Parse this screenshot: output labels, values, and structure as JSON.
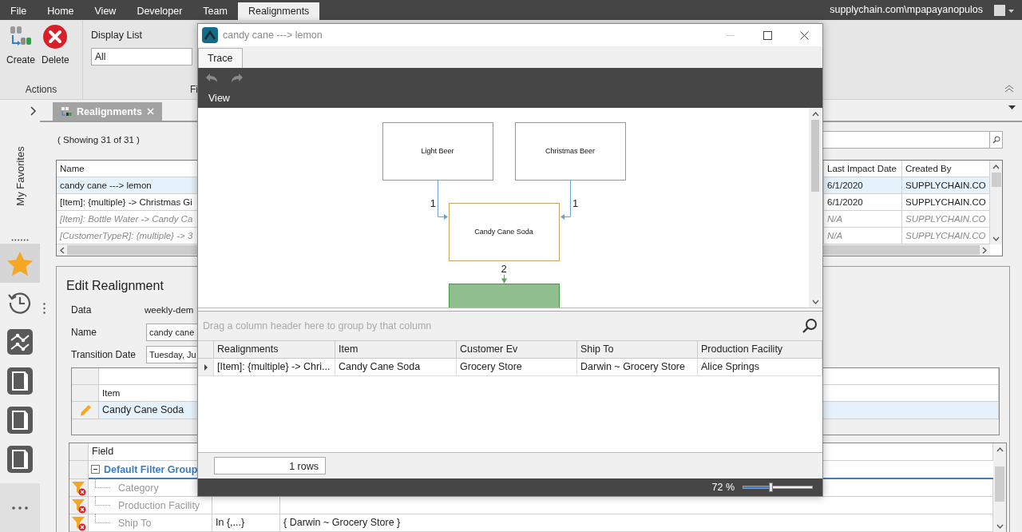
{
  "menu_bar": {
    "items": [
      {
        "label": "File",
        "selected": false
      },
      {
        "label": "Home",
        "selected": false
      },
      {
        "label": "View",
        "selected": false
      },
      {
        "label": "Developer",
        "selected": false
      },
      {
        "label": "Team",
        "selected": false
      },
      {
        "label": "Realignments",
        "selected": true
      }
    ],
    "user": "supplychain.com\\mpapayanopulos"
  },
  "ribbon": {
    "groups": [
      {
        "kind": "buttons",
        "label": "Actions",
        "buttons": [
          {
            "label": "Create",
            "kind": "create"
          },
          {
            "label": "Delete",
            "kind": "delete"
          }
        ]
      },
      {
        "kind": "list",
        "label": "Fi",
        "field_label": "Display List",
        "value": "All"
      }
    ]
  },
  "sidebar": {
    "title": "My Favorites",
    "items": [
      {
        "kind": "star",
        "selected": true
      },
      {
        "kind": "history",
        "selected": false
      },
      {
        "kind": "chart",
        "selected": false
      },
      {
        "kind": "document",
        "selected": false
      },
      {
        "kind": "document",
        "selected": false
      },
      {
        "kind": "document",
        "selected": false
      }
    ]
  },
  "document_tab": {
    "label": "Realignments"
  },
  "list": {
    "count": "( Showing 31 of 31 )",
    "columns": [
      "Name",
      "Last Impact Date",
      "Created By"
    ],
    "rows": [
      {
        "name": "candy cane ---> lemon",
        "last_impact_date": "6/1/2020",
        "created_by": "SUPPLYCHAIN.CO",
        "selected": true,
        "disabled": false
      },
      {
        "name": "[Item]: {multiple} -> Christmas Gi",
        "last_impact_date": "6/1/2020",
        "created_by": "SUPPLYCHAIN.CO",
        "selected": false,
        "disabled": false
      },
      {
        "name": "[Item]: Bottle Water -> Candy Ca",
        "last_impact_date": "N/A",
        "created_by": "SUPPLYCHAIN.CO",
        "selected": false,
        "disabled": true
      },
      {
        "name": "[CustomerTypeR]: {multiple} -> 3",
        "last_impact_date": "N/A",
        "created_by": "SUPPLYCHAIN.CO",
        "selected": false,
        "disabled": true
      }
    ]
  },
  "edit_panel": {
    "title": "Edit Realignment",
    "fields": [
      {
        "label": "Data",
        "value": "weekly-dem",
        "kind": "text"
      },
      {
        "label": "Name",
        "value": "candy cane",
        "kind": "input"
      },
      {
        "label": "Transition Date",
        "value": "Tuesday, Ju",
        "kind": "input"
      }
    ],
    "items_grid": {
      "column": "Item",
      "rows": [
        {
          "value": "Candy Cane Soda",
          "selected": true
        }
      ]
    },
    "filter_grid": {
      "column": "Field",
      "groups": [
        {
          "label": "Default Filter Group",
          "expanded": true,
          "children": [
            {
              "field": "Category"
            },
            {
              "field": "Production Facility"
            },
            {
              "field": "Ship To",
              "column_2": "In {,...}",
              "column_3": "{ Darwin ~ Grocery Store }"
            }
          ]
        }
      ]
    }
  },
  "trace_window": {
    "title": "candy cane ---> lemon",
    "tabs": [
      {
        "label": "Trace",
        "selected": true
      }
    ],
    "toolbar": [
      {
        "kind": "undo",
        "disabled": true
      },
      {
        "kind": "redo",
        "disabled": true
      }
    ],
    "menu": [
      "View"
    ],
    "diagram": {
      "nodes": [
        {
          "label": "Light Beer",
          "color": "#6e9fd8",
          "kind": "outline"
        },
        {
          "label": "Christmas Beer",
          "color": "#6e9fd8",
          "kind": "outline"
        },
        {
          "label": "Candy Cane Soda",
          "color": "#c9a45c",
          "kind": "outline"
        },
        {
          "color": "#3f9b3f",
          "kind": "filled"
        }
      ],
      "edges": [
        {
          "label": "1",
          "color": "#6e9fd8"
        },
        {
          "label": "1",
          "color": "#6e9fd8"
        },
        {
          "label": "2",
          "color": "#5aa85a"
        }
      ]
    },
    "grid": {
      "group_panel": "Drag a column header here to group by that column",
      "columns": [
        "Realignments",
        "Item",
        "Customer Ev",
        "Ship To",
        "Production Facility"
      ],
      "rows": [
        {
          "cells": [
            "[Item]: {multiple} -> Chri...",
            "Candy Cane Soda",
            "Grocery Store",
            "Darwin ~ Grocery Store",
            "Alice Springs"
          ]
        }
      ],
      "footer": "1 rows"
    },
    "zoom": {
      "reading": "72 %",
      "level": 0.41
    }
  }
}
